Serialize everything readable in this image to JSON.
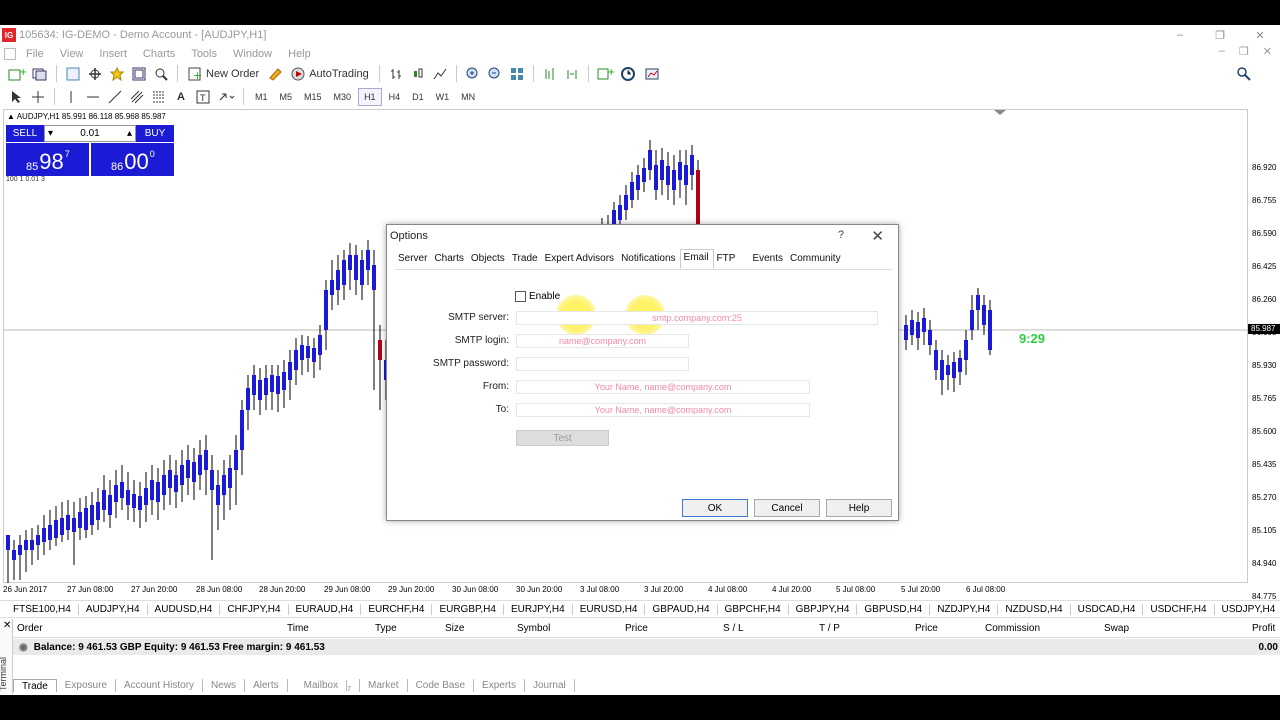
{
  "window": {
    "title": "105634: IG-DEMO - Demo Account - [AUDJPY,H1]",
    "logo": "IG"
  },
  "menu": [
    "File",
    "View",
    "Insert",
    "Charts",
    "Tools",
    "Window",
    "Help"
  ],
  "toolbar": {
    "new_order": "New Order",
    "autotrading": "AutoTrading"
  },
  "timeframes": [
    "M1",
    "M5",
    "M15",
    "M30",
    "H1",
    "H4",
    "D1",
    "W1",
    "MN"
  ],
  "active_timeframe": "H1",
  "chart": {
    "symbol_info": "AUDJPY,H1  85.991 86.118 85.968 85.987",
    "price_labels": [
      "86.920",
      "86.755",
      "86.590",
      "86.425",
      "86.260",
      "86.095",
      "85.930",
      "85.765",
      "85.600",
      "85.435",
      "85.270",
      "85.105",
      "84.940",
      "84.775"
    ],
    "current_price": "85.987",
    "time_labels": [
      "26 Jun 2017",
      "27 Jun 08:00",
      "27 Jun 20:00",
      "28 Jun 08:00",
      "28 Jun 20:00",
      "29 Jun 08:00",
      "29 Jun 20:00",
      "30 Jun 08:00",
      "30 Jun 20:00",
      "3 Jul 08:00",
      "3 Jul 20:00",
      "4 Jul 08:00",
      "4 Jul 20:00",
      "5 Jul 08:00",
      "5 Jul 20:00",
      "6 Jul 08:00"
    ],
    "timer": "9:29",
    "colors": {
      "bull": "#1b1bd6",
      "bear": "#b1001a"
    }
  },
  "one_click": {
    "sell": "SELL",
    "buy": "BUY",
    "lots": "0.01",
    "sell_prefix": "85",
    "sell_big": "98",
    "sell_sup": "7",
    "buy_prefix": "86",
    "buy_big": "00",
    "buy_sup": "0",
    "sub": "100 1 0.01 3"
  },
  "symbol_tabs": [
    "FTSE100,H4",
    "AUDJPY,H4",
    "AUDUSD,H4",
    "CHFJPY,H4",
    "EURAUD,H4",
    "EURCHF,H4",
    "EURGBP,H4",
    "EURJPY,H4",
    "EURUSD,H4",
    "GBPAUD,H4",
    "GBPCHF,H4",
    "GBPJPY,H4",
    "GBPUSD,H4",
    "NZDJPY,H4",
    "NZDUSD,H4",
    "USDCAD,H4",
    "USDCHF,H4",
    "USDJPY,H4"
  ],
  "terminal": {
    "side_label": "Terminal",
    "columns": [
      "Order",
      "Time",
      "Type",
      "Size",
      "Symbol",
      "Price",
      "S / L",
      "T / P",
      "Price",
      "Commission",
      "Swap",
      "Profit"
    ],
    "balance_text": "Balance: 9 461.53 GBP  Equity: 9 461.53  Free margin: 9 461.53",
    "balance_profit": "0.00",
    "tabs": [
      "Trade",
      "Exposure",
      "Account History",
      "News",
      "Alerts",
      "Mailbox",
      "Market",
      "Code Base",
      "Experts",
      "Journal"
    ],
    "mailbox_count": "7",
    "active_tab": "Trade"
  },
  "dialog": {
    "title": "Options",
    "help_symbol": "?",
    "tabs": [
      "Server",
      "Charts",
      "Objects",
      "Trade",
      "Expert Advisors",
      "Notifications",
      "Email",
      "FTP",
      "Events",
      "Community"
    ],
    "active_tab": "Email",
    "enable_label": "Enable",
    "enable_checked": false,
    "fields": {
      "smtp_server": {
        "label": "SMTP server:",
        "placeholder": "smtp.company.com:25"
      },
      "smtp_login": {
        "label": "SMTP login:",
        "placeholder": "name@company.com"
      },
      "smtp_password": {
        "label": "SMTP password:",
        "placeholder": ""
      },
      "from": {
        "label": "From:",
        "placeholder": "Your Name, name@company.com"
      },
      "to": {
        "label": "To:",
        "placeholder": "Your Name, name@company.com"
      }
    },
    "test_button": "Test",
    "ok_button": "OK",
    "cancel_button": "Cancel",
    "help_button": "Help"
  }
}
